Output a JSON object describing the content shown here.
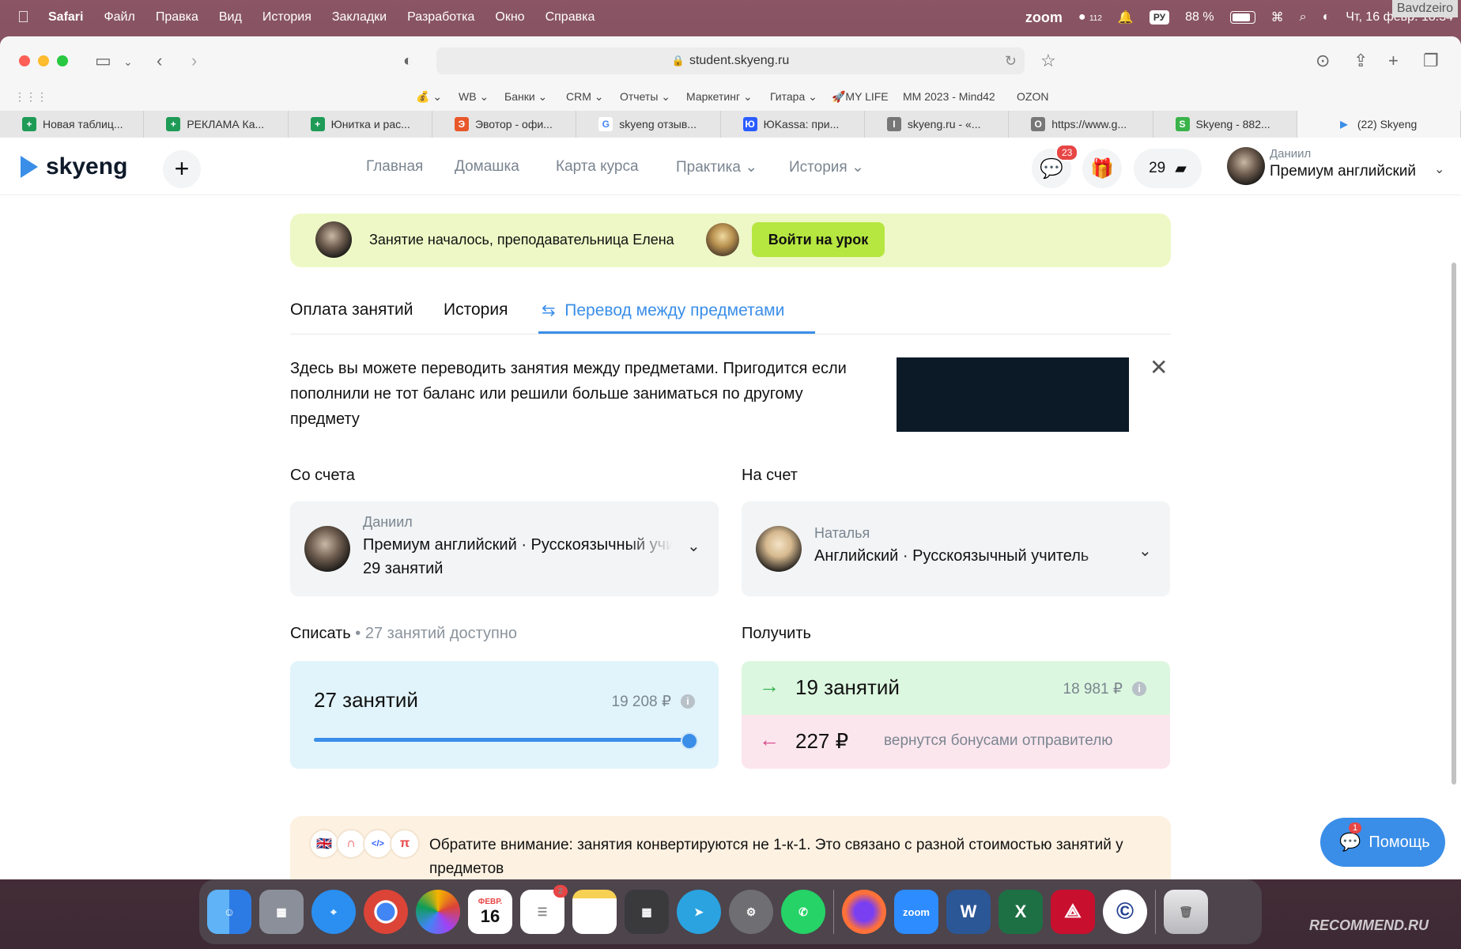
{
  "menubar": {
    "app": "Safari",
    "items": [
      "Файл",
      "Правка",
      "Вид",
      "История",
      "Закладки",
      "Разработка",
      "Окно",
      "Справка"
    ],
    "zoom": "zoom",
    "notif_count": "112",
    "input_lang": "РУ",
    "battery": "88 %",
    "clock": "Чт, 16 февр. 18:34",
    "watermark": "Bavdzeiro"
  },
  "browser": {
    "url": "student.skyeng.ru",
    "favorites": [
      {
        "label": "💰",
        "color": "#c4a000"
      },
      {
        "label": "WB"
      },
      {
        "label": "Банки"
      },
      {
        "label": "CRM"
      },
      {
        "label": "Отчеты"
      },
      {
        "label": "Маркетинг"
      },
      {
        "label": "Гитара"
      },
      {
        "label": "🚀MY LIFE"
      },
      {
        "label": "MM 2023 - Mind42"
      },
      {
        "label": "OZON"
      }
    ],
    "tabs": [
      {
        "title": "Новая таблиц...",
        "icon": "+",
        "color": "#1e9b56"
      },
      {
        "title": "РЕКЛАМА Ка...",
        "icon": "+",
        "color": "#1e9b56"
      },
      {
        "title": "Юнитка и рас...",
        "icon": "+",
        "color": "#1e9b56"
      },
      {
        "title": "Эвотор - офи...",
        "icon": "Э",
        "color": "#e8572a"
      },
      {
        "title": "skyeng отзыв...",
        "icon": "G",
        "color": "#4285f4"
      },
      {
        "title": "ЮKassa: при...",
        "icon": "Ю",
        "color": "#2a5cff"
      },
      {
        "title": "skyeng.ru - «...",
        "icon": "I",
        "color": "#777777"
      },
      {
        "title": "https://www.g...",
        "icon": "O",
        "color": "#777777"
      },
      {
        "title": "Skyeng - 882...",
        "icon": "S",
        "color": "#3ab34a"
      },
      {
        "title": "(22) Skyeng",
        "icon": "▶",
        "color": "#3a8ee8"
      }
    ]
  },
  "header": {
    "logo": "skyeng",
    "nav": [
      "Главная",
      "Домашка",
      "Карта курса",
      "Практика",
      "История"
    ],
    "messages_badge": "23",
    "balance": "29",
    "profile_name": "Даниил",
    "profile_course": "Премиум английский"
  },
  "banner": {
    "text": "Занятие началось, преподавательница Елена",
    "button": "Войти на урок"
  },
  "tabs": {
    "payment": "Оплата занятий",
    "history": "История",
    "transfer": "Перевод между предметами"
  },
  "info": {
    "text": "Здесь вы можете переводить занятия между предметами. Пригодится если пополнили не тот баланс или решили больше заниматься по другому предмету"
  },
  "transfer": {
    "from_label": "Со счета",
    "to_label": "На счет",
    "from": {
      "name": "Даниил",
      "description": "Премиум английский · Русскоязычный учитель",
      "count": "29 занятий"
    },
    "to": {
      "name": "Наталья",
      "description": "Английский · Русскоязычный учитель"
    },
    "writeoff_label": "Списать",
    "available": "• 27 занятий доступно",
    "writeoff_qty": "27 занятий",
    "writeoff_price": "19 208 ₽",
    "slider_fraction": 1.0,
    "receive_label": "Получить",
    "receive_qty": "19 занятий",
    "receive_price": "18 981 ₽",
    "refund_amount": "227 ₽",
    "refund_note": "вернутся бонусами отправителю"
  },
  "notice": {
    "text": "Обратите внимание: занятия конвертируются не 1-к-1. Это связано с разной стоимостью занятий у предметов",
    "icons": [
      "🇬🇧",
      "∩",
      "</>",
      "π"
    ]
  },
  "help": {
    "label": "Помощь",
    "badge": "1"
  },
  "dock": {
    "calendar_month": "ФЕВР.",
    "calendar_day": "16",
    "reminders_badge": "2",
    "zoom": "zoom",
    "word": "W",
    "excel": "X"
  },
  "watermark_bottom": "RECOMMEND.RU"
}
